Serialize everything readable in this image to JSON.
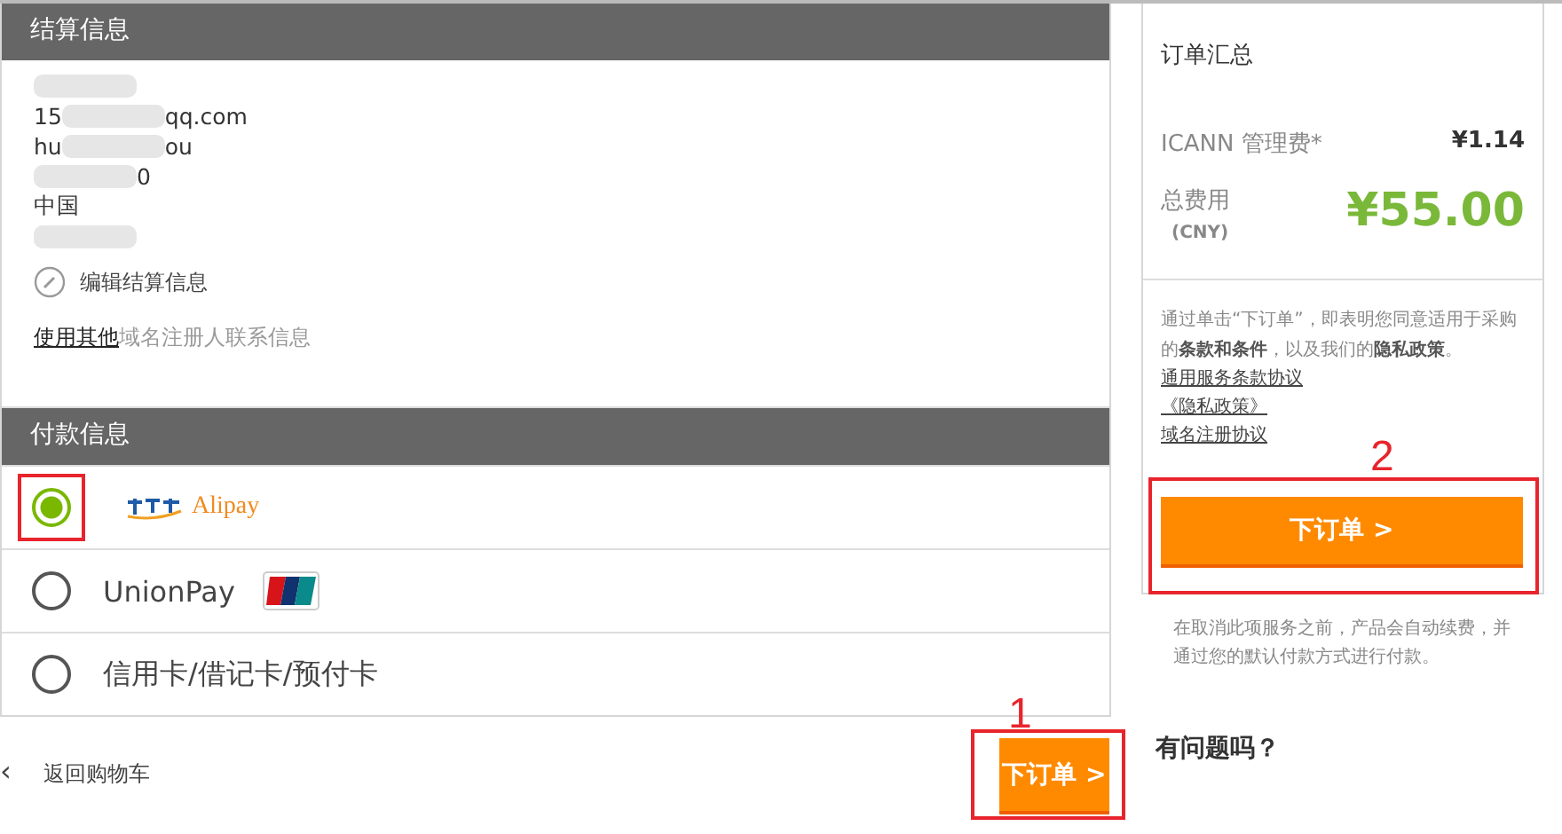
{
  "billing": {
    "title": "结算信息",
    "lines": [
      {
        "parts": [
          {
            "kind": "blur"
          }
        ]
      },
      {
        "parts": [
          {
            "kind": "text",
            "text": "15"
          },
          {
            "kind": "blur"
          },
          {
            "kind": "text",
            "text": "qq.com"
          }
        ]
      },
      {
        "parts": [
          {
            "kind": "text",
            "text": "hu"
          },
          {
            "kind": "blur"
          },
          {
            "kind": "text",
            "text": "ou"
          }
        ]
      },
      {
        "parts": [
          {
            "kind": "blur"
          },
          {
            "kind": "text",
            "text": "0"
          }
        ]
      },
      {
        "parts": [
          {
            "kind": "text",
            "text": "中国"
          }
        ]
      },
      {
        "parts": [
          {
            "kind": "blur"
          }
        ]
      }
    ],
    "edit_link": "编辑结算信息",
    "other_link": "使用其他",
    "other_text": "域名注册人联系信息"
  },
  "payment": {
    "title": "付款信息",
    "methods": [
      {
        "kind": "alipay",
        "logo_text": "Alipay",
        "selected": true
      },
      {
        "kind": "unionpay",
        "label": "UnionPay",
        "selected": false
      },
      {
        "kind": "card",
        "label": "信用卡/借记卡/预付卡",
        "selected": false
      }
    ]
  },
  "back_link": "返回购物车",
  "back_arrow": "‹",
  "order_button": "下订单 >",
  "summary": {
    "title": "订单汇总",
    "fee_label": "ICANN 管理费*",
    "fee_value": "¥1.14",
    "total_label": "总费用",
    "currency": "(CNY)",
    "total_value": "¥55.00",
    "terms": "通过单击“下订单”，即表明您同意适用于采购的**条款和条件**，以及我们的**隐私政策**。",
    "links": [
      "通用服务条款协议",
      "《隐私政策》",
      "域名注册协议"
    ],
    "order_button": "下订单 >"
  },
  "renew_note": "在取消此项服务之前，产品会自动续费，并通过您的默认付款方式进行付款。",
  "help_title": "有问题吗？",
  "annotations": [
    "1",
    "2"
  ]
}
